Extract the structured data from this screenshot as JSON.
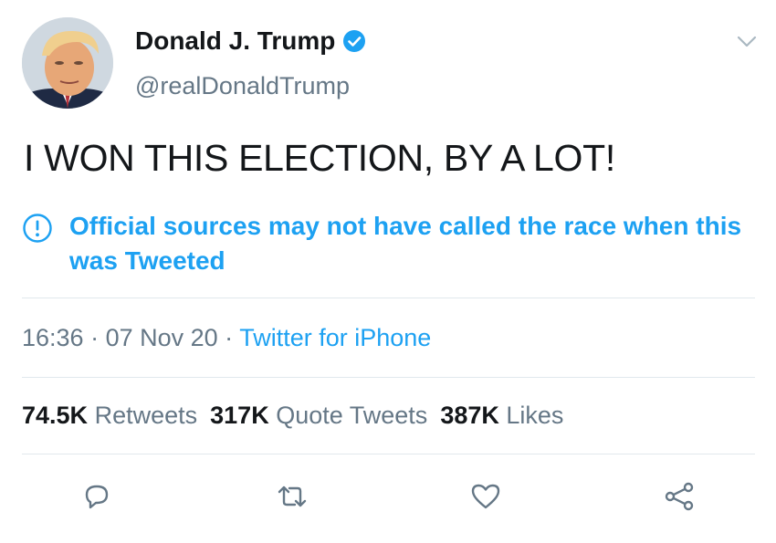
{
  "author": {
    "display_name": "Donald J. Trump",
    "handle": "@realDonaldTrump",
    "verified_icon": "verified-badge-icon",
    "avatar": "profile-photo"
  },
  "tweet": {
    "text": "I WON THIS ELECTION, BY A LOT!"
  },
  "notice": {
    "icon": "exclamation-circle-icon",
    "text": "Official sources may not have called the race when this was Tweeted"
  },
  "meta": {
    "time": "16:36",
    "sep1": " · ",
    "date": "07 Nov 20",
    "sep2": " · ",
    "source": "Twitter for iPhone"
  },
  "stats": {
    "retweets_count": "74.5K",
    "retweets_label": "Retweets",
    "quotes_count": "317K",
    "quotes_label": "Quote Tweets",
    "likes_count": "387K",
    "likes_label": "Likes"
  },
  "actions": {
    "reply_icon": "reply-icon",
    "retweet_icon": "retweet-icon",
    "like_icon": "heart-icon",
    "share_icon": "share-icon"
  },
  "colors": {
    "accent": "#1da1f2",
    "secondary_text": "#657786",
    "primary_text": "#14171a",
    "divider": "#e1e8ed"
  }
}
